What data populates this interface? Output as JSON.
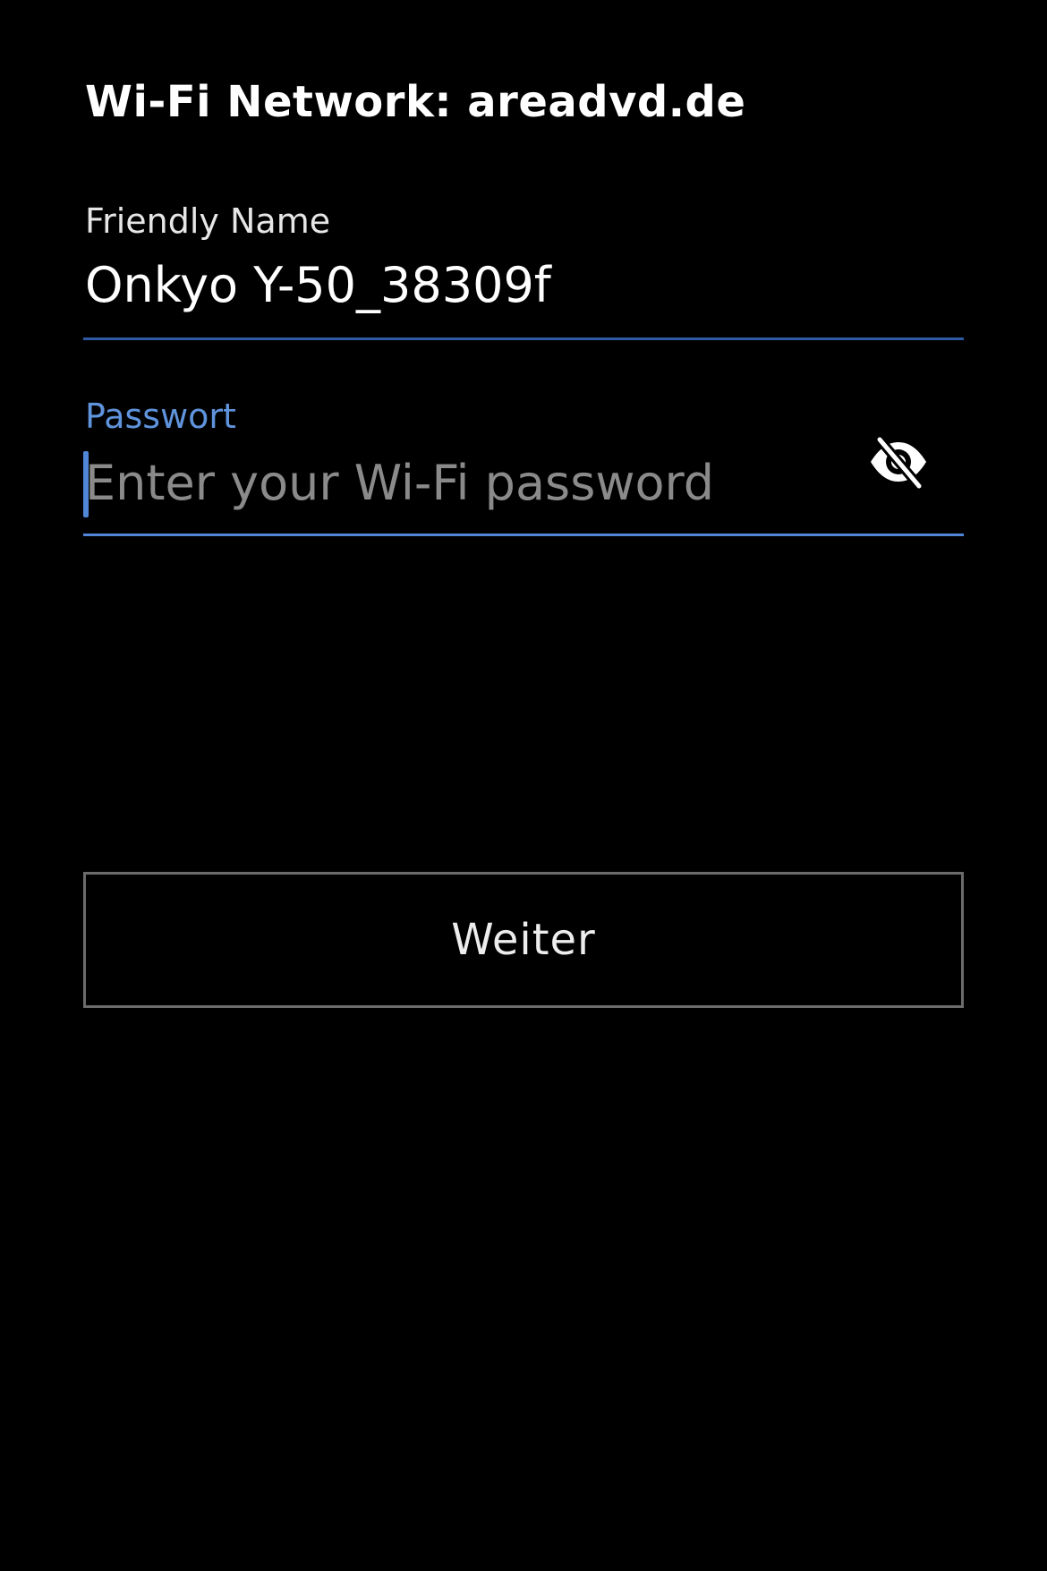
{
  "page": {
    "title": "Wi-Fi Network: areadvd.de"
  },
  "form": {
    "friendly_name": {
      "label": "Friendly Name",
      "value": "Onkyo Y-50_38309f"
    },
    "password": {
      "label": "Passwort",
      "value": "",
      "placeholder": "Enter your Wi-Fi password",
      "visibility_icon": "eye-off-icon"
    },
    "continue_label": "Weiter"
  },
  "colors": {
    "background": "#000000",
    "accent": "#4f86d8",
    "friendly_underline": "#2f5aa3",
    "button_border": "#6b6b6b",
    "placeholder": "#8a8a8a"
  }
}
